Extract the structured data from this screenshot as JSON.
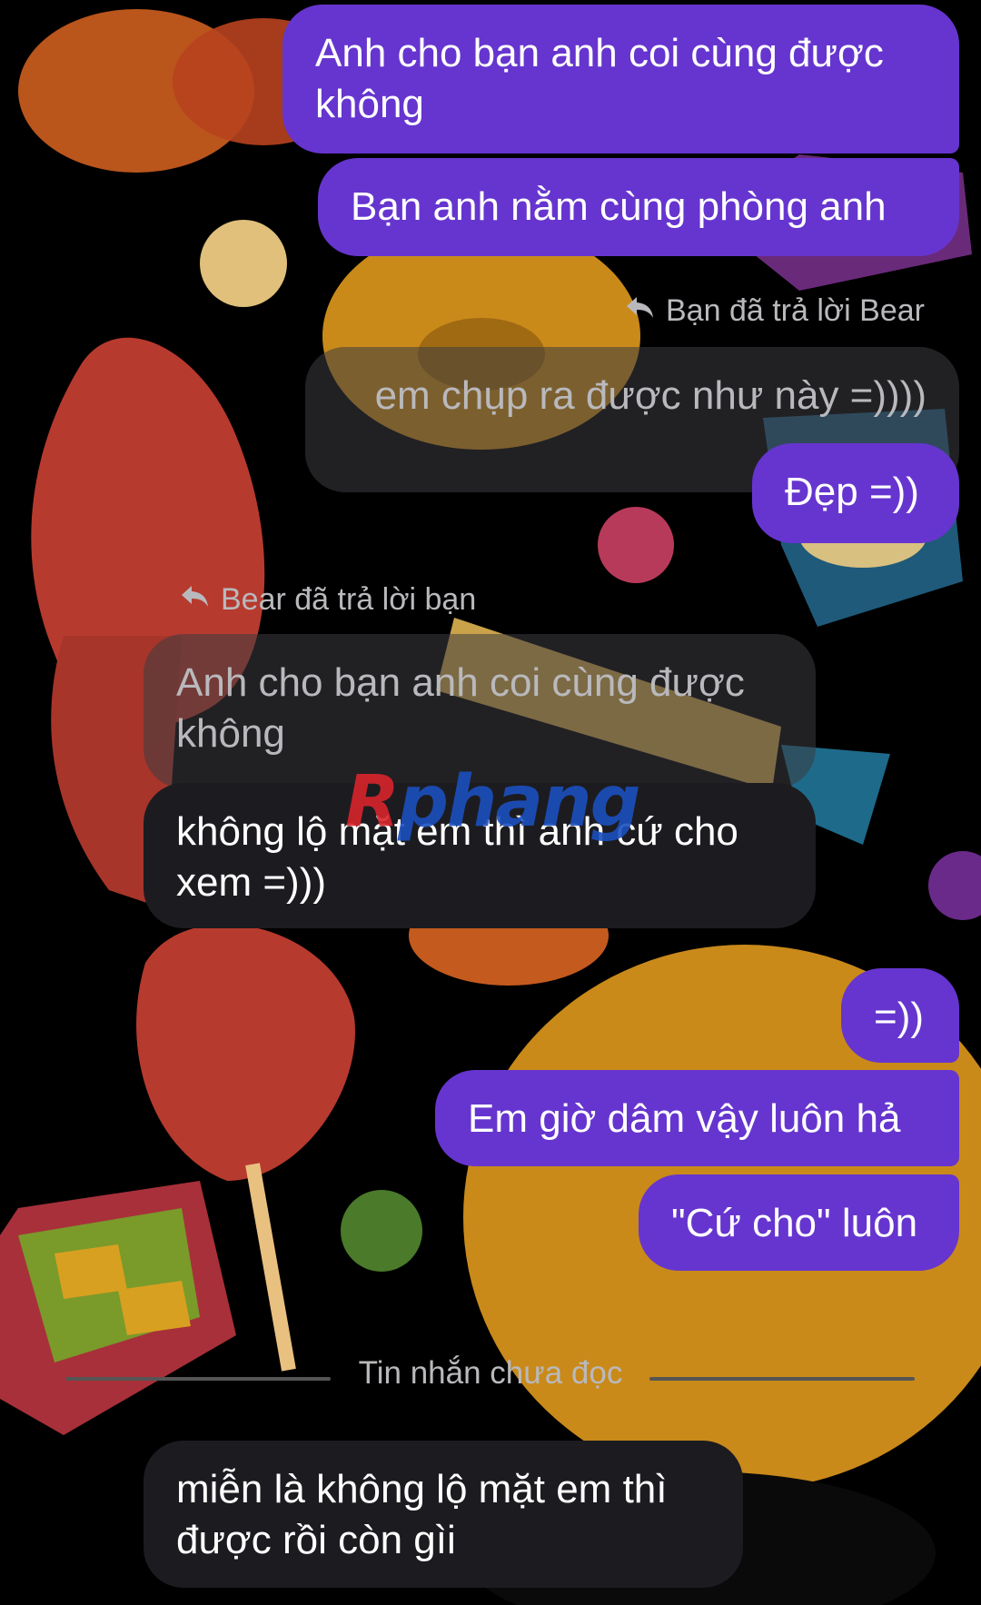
{
  "colors": {
    "outgoing_bubble": "#6635cf",
    "incoming_bubble": "#1c1c20",
    "quoted_bubble": "#3c3c42",
    "meta_text": "#b9b9bd",
    "background": "#000000"
  },
  "messages": [
    {
      "id": "m1",
      "sender": "me",
      "text": "Anh cho bạn anh coi cùng được không"
    },
    {
      "id": "m2",
      "sender": "me",
      "text": "Bạn anh nằm cùng phòng anh"
    },
    {
      "id": "m3",
      "sender": "me",
      "reply_note": "Bạn đã trả lời Bear",
      "quoted_text": "em chụp ra được như này =))))",
      "text": "Đẹp =))"
    },
    {
      "id": "m4",
      "sender": "Bear",
      "reply_note": "Bear đã trả lời bạn",
      "quoted_text": "Anh cho bạn anh coi cùng được không",
      "text": "không lộ mặt em thì anh cứ cho xem =)))"
    },
    {
      "id": "m5",
      "sender": "me",
      "text": "=))"
    },
    {
      "id": "m6",
      "sender": "me",
      "text": "Em giờ dâm vậy luôn hả"
    },
    {
      "id": "m7",
      "sender": "me",
      "text": "\"Cứ cho\" luôn"
    },
    {
      "id": "m8",
      "sender": "Bear",
      "text": "miễn là không lộ mặt em thì được rồi còn gìi"
    }
  ],
  "unread_divider": "Tin nhắn chưa đọc",
  "watermark": {
    "part1": "R",
    "part2": "phang"
  },
  "icons": {
    "reply_arrow": "reply-arrow-icon"
  }
}
